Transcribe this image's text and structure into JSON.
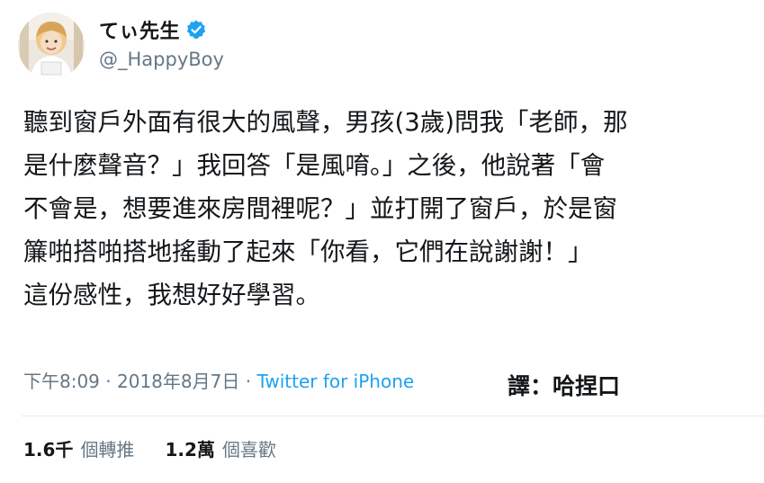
{
  "author": {
    "display_name": "てぃ先生",
    "handle": "@_HappyBoy"
  },
  "tweet": {
    "lines": [
      "聽到窗戶外面有很大的風聲，男孩(3歲)問我「老師，那",
      "是什麼聲音？」我回答「是風唷。」之後，他說著「會",
      "不會是，想要進來房間裡呢？」並打開了窗戶，於是窗",
      "簾啪搭啪搭地搖動了起來「你看，它們在說謝謝！」",
      "這份感性，我想好好學習。"
    ]
  },
  "meta": {
    "time": "下午8:09",
    "separator": " · ",
    "date": "2018年8月7日",
    "source": "Twitter for iPhone"
  },
  "translator_note": "譯：哈捏口",
  "stats": {
    "retweets_count": "1.6千",
    "retweets_label": "個轉推",
    "likes_count": "1.2萬",
    "likes_label": "個喜歡"
  },
  "colors": {
    "verified": "#1da1f2",
    "link": "#1da1f2",
    "secondary_text": "#657786"
  },
  "icons": {
    "verified": "verified-badge-icon"
  }
}
